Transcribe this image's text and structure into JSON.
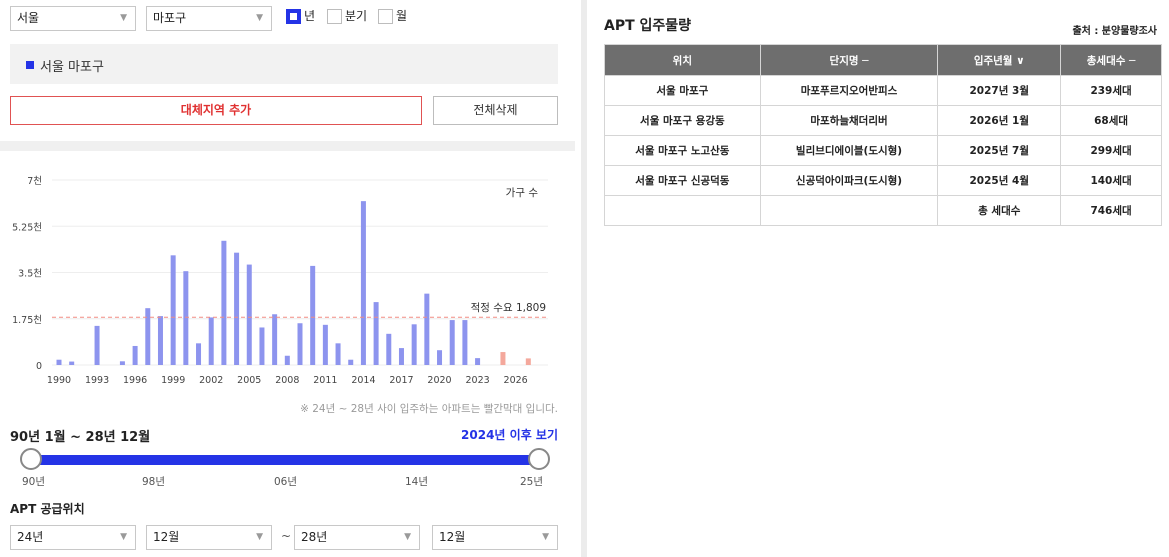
{
  "filters": {
    "city": "서울",
    "district": "마포구",
    "period_options": [
      {
        "label": "년",
        "checked": true
      },
      {
        "label": "분기",
        "checked": false
      },
      {
        "label": "월",
        "checked": false
      }
    ]
  },
  "region": {
    "name": "서울 마포구"
  },
  "buttons": {
    "add_alt": "대체지역 추가",
    "delete_all": "전체삭제"
  },
  "chart_data": {
    "type": "bar",
    "legend": "가구 수",
    "yticks": [
      "7천",
      "5.25천",
      "3.5천",
      "1.75천",
      "0"
    ],
    "ylim": [
      0,
      7000
    ],
    "xticks": [
      "1990",
      "1993",
      "1996",
      "1999",
      "2002",
      "2005",
      "2008",
      "2011",
      "2014",
      "2017",
      "2020",
      "2023",
      "2026"
    ],
    "reference_line": {
      "label": "적정 수요 1,809",
      "value": 1809
    },
    "series": [
      {
        "x": [
          1990,
          1991,
          1992,
          1993,
          1994,
          1995,
          1996,
          1997,
          1998,
          1999,
          2000,
          2001,
          2002,
          2003,
          2004,
          2005,
          2006,
          2007,
          2008,
          2009,
          2010,
          2011,
          2012,
          2013,
          2014,
          2015,
          2016,
          2017,
          2018,
          2019,
          2020,
          2021,
          2022,
          2023,
          2024,
          2025,
          2026,
          2027,
          2028
        ],
        "values": [
          200,
          130,
          0,
          1480,
          0,
          140,
          720,
          2150,
          1850,
          4150,
          3550,
          820,
          1800,
          4700,
          4250,
          3800,
          1420,
          1920,
          350,
          1580,
          3750,
          1520,
          820,
          200,
          6200,
          2380,
          1180,
          640,
          1540,
          2700,
          560,
          1700,
          1700,
          260,
          0,
          490,
          0,
          250,
          0
        ],
        "highlight_from": 2024,
        "color": "#8d94ee",
        "highlight_color": "#f4a89c"
      }
    ]
  },
  "note": "※ 24년 ~ 28년 사이 입주하는 아파트는 빨간막대 입니다.",
  "range": {
    "title": "90년 1월 ~ 28년 12월",
    "link": "2024년 이후 보기",
    "ticks": [
      "90년",
      "98년",
      "06년",
      "14년",
      "25년"
    ]
  },
  "supply": {
    "title": "APT 공급위치",
    "start_year": "24년",
    "start_month": "12월",
    "separator": "~",
    "end_year": "28년",
    "end_month": "12월"
  },
  "table": {
    "title": "APT 입주물량",
    "source": "출처 : 분양물량조사",
    "headers": [
      "위치",
      "단지명 ─",
      "입주년월 ∨",
      "총세대수 ─"
    ],
    "rows": [
      [
        "서울 마포구",
        "마포푸르지오어반피스",
        "2027년 3월",
        "239세대"
      ],
      [
        "서울 마포구 용강동",
        "마포하늘채더리버",
        "2026년 1월",
        "68세대"
      ],
      [
        "서울 마포구 노고산동",
        "빌리브디에이블(도시형)",
        "2025년 7월",
        "299세대"
      ],
      [
        "서울 마포구 신공덕동",
        "신공덕아이파크(도시형)",
        "2025년 4월",
        "140세대"
      ]
    ],
    "total": {
      "label": "총 세대수",
      "value": "746세대"
    }
  }
}
